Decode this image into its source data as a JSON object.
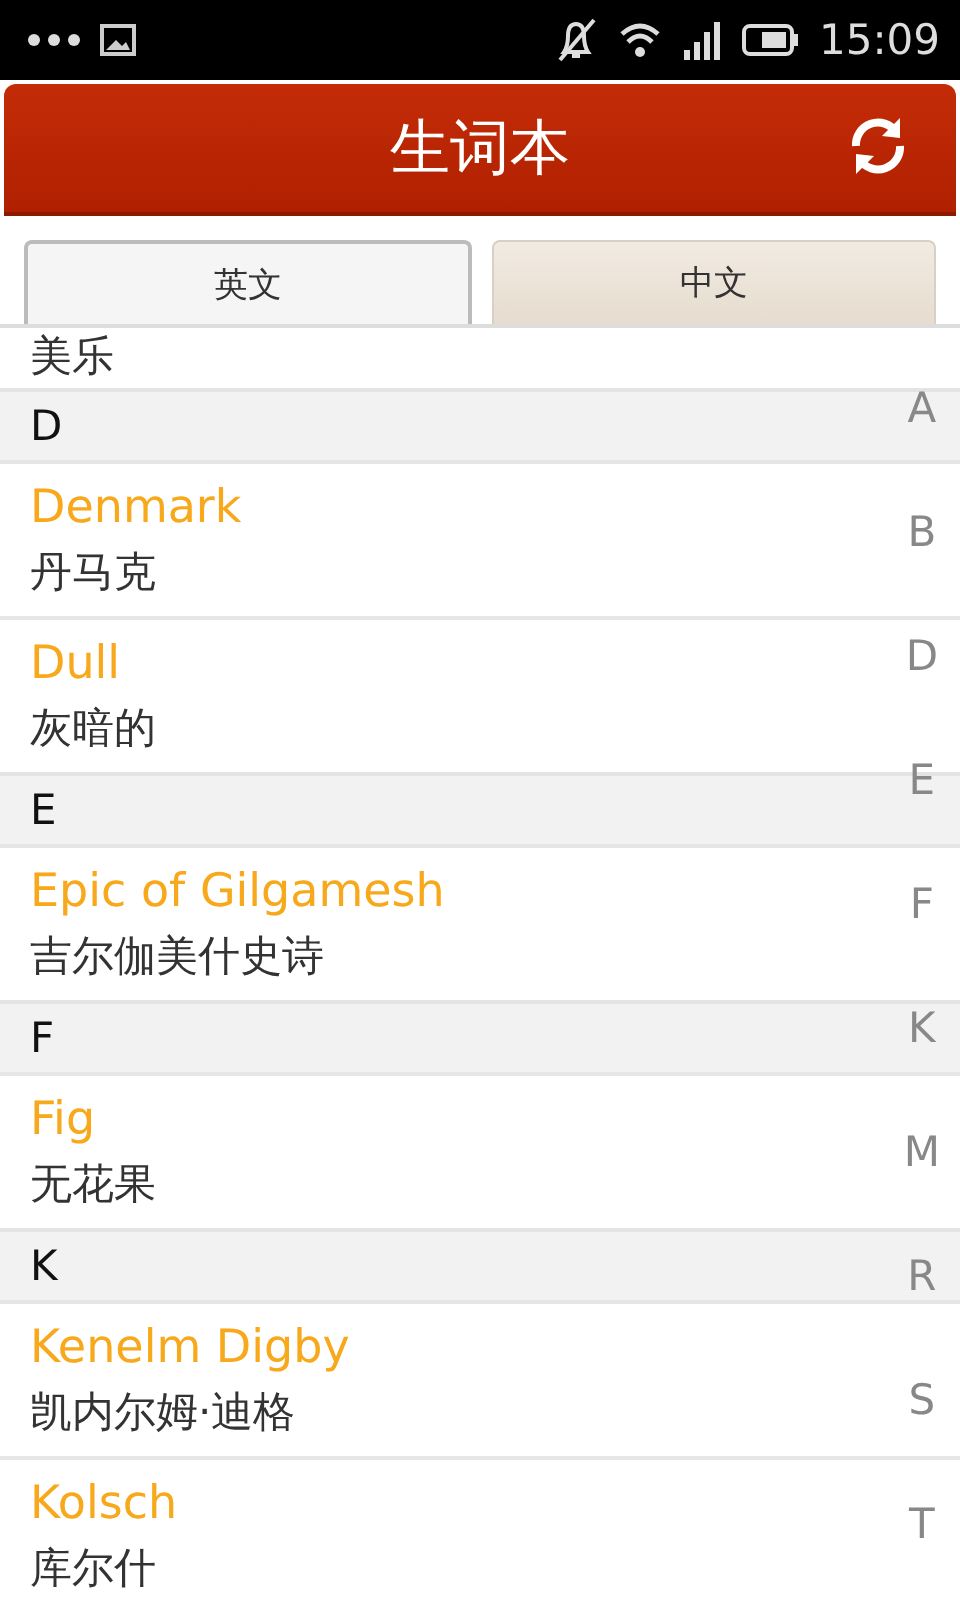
{
  "status_bar": {
    "time": "15:09"
  },
  "header": {
    "title": "生词本"
  },
  "tabs": [
    {
      "label": "英文",
      "selected": true
    },
    {
      "label": "中文",
      "selected": false
    }
  ],
  "list": [
    {
      "kind": "entry",
      "meaning": "美乐"
    },
    {
      "kind": "section",
      "label": "D"
    },
    {
      "kind": "entry",
      "word": "Denmark",
      "meaning": "丹马克"
    },
    {
      "kind": "entry",
      "word": "Dull",
      "meaning": "灰暗的"
    },
    {
      "kind": "section",
      "label": "E"
    },
    {
      "kind": "entry",
      "word": "Epic of Gilgamesh",
      "meaning": "吉尔伽美什史诗"
    },
    {
      "kind": "section",
      "label": "F"
    },
    {
      "kind": "entry",
      "word": "Fig",
      "meaning": "无花果"
    },
    {
      "kind": "section",
      "label": "K"
    },
    {
      "kind": "entry",
      "word": "Kenelm Digby",
      "meaning": "凯内尔姆·迪格"
    },
    {
      "kind": "entry",
      "word": "Kolsch",
      "meaning": "库尔什"
    }
  ],
  "index": [
    "A",
    "B",
    "D",
    "E",
    "F",
    "K",
    "M",
    "R",
    "S",
    "T"
  ]
}
